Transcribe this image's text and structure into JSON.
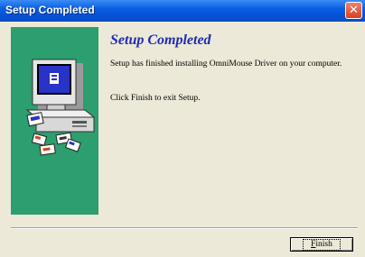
{
  "window": {
    "title": "Setup Completed"
  },
  "icons": {
    "close": "close-icon",
    "illustration": "computer-setup-illustration"
  },
  "content": {
    "heading": "Setup Completed",
    "message1": "Setup has finished installing OmniMouse Driver on your computer.",
    "message2": "Click Finish to exit Setup."
  },
  "buttons": {
    "finish_mnemonic": "F",
    "finish_rest": "inish"
  },
  "colors": {
    "titlebar": "#0553d6",
    "side_panel": "#2c9e6f",
    "heading": "#1f2bb0",
    "close": "#d8401c"
  }
}
